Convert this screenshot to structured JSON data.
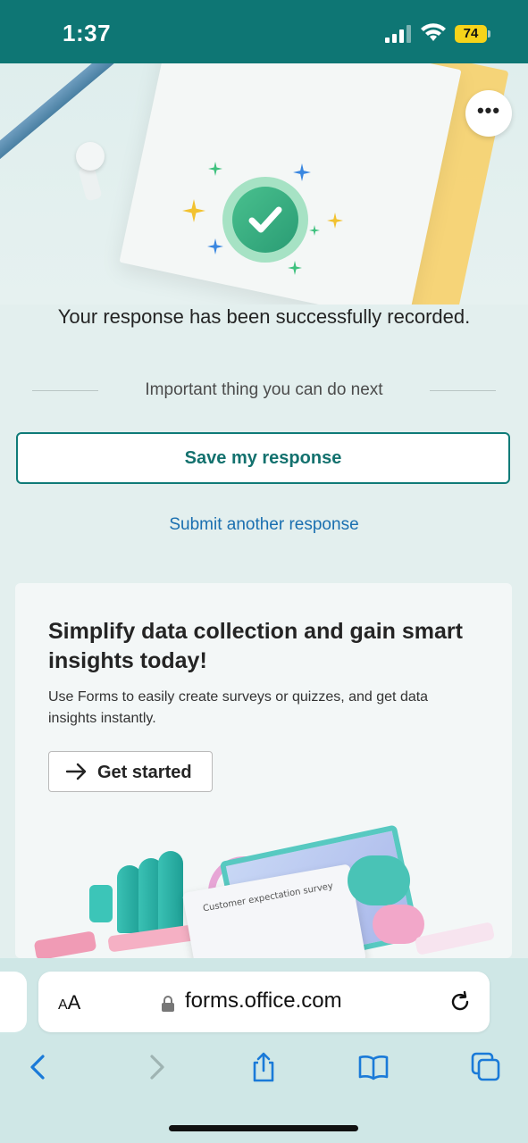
{
  "status_bar": {
    "time": "1:37",
    "battery": "74"
  },
  "hero": {
    "more_label": "•••"
  },
  "main": {
    "success_message": "Your response has been successfully recorded.",
    "next_heading": "Important thing you can do next",
    "save_button": "Save my response",
    "another_link": "Submit another response"
  },
  "promo": {
    "title": "Simplify data collection and gain smart insights today!",
    "body": "Use Forms to easily create surveys or quizzes, and get data insights instantly.",
    "cta": "Get started",
    "illustration_caption": "Customer expectation survey"
  },
  "browser": {
    "aa_label_small": "A",
    "aa_label_large": "A",
    "url": "forms.office.com"
  },
  "colors": {
    "accent": "#0e7674",
    "link": "#1a6fb0",
    "battery": "#f6d31a"
  }
}
